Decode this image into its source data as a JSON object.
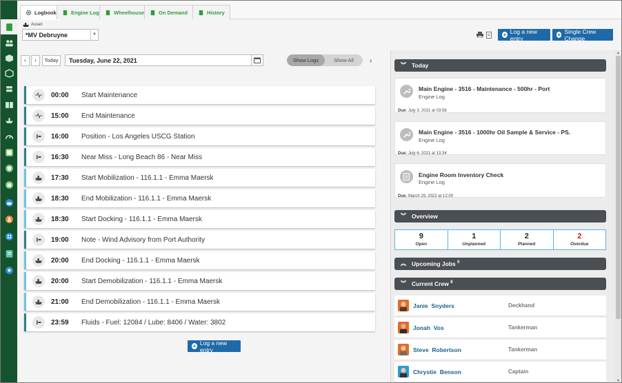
{
  "tabs": [
    {
      "label": "Logbook",
      "active": true
    },
    {
      "label": "Engine Log",
      "active": false
    },
    {
      "label": "Wheelhouse",
      "active": false
    },
    {
      "label": "On Demand",
      "active": false
    },
    {
      "label": "History",
      "active": false
    }
  ],
  "asset": {
    "label": "Asset",
    "value": "*MV Debruyne"
  },
  "toolbar": {
    "log_entry_label": "Log a new entry",
    "single_crew_label": "Single Crew Change",
    "today_label": "Today",
    "date": "Tuesday, June 22, 2021",
    "show_logs": "Show Logs",
    "show_all": "Show All"
  },
  "logs": [
    {
      "time": "00:00",
      "text": "Start Maintenance",
      "icon": "wave-icon"
    },
    {
      "time": "15:00",
      "text": "End Maintenance",
      "icon": "wave-icon"
    },
    {
      "time": "16:00",
      "text": "Position - Los Angeles USCG Station",
      "icon": "note-icon"
    },
    {
      "time": "16:30",
      "text": "Near Miss - Long Beach 86 - Near Miss",
      "icon": "note-icon"
    },
    {
      "time": "17:30",
      "text": "Start Mobilization - 116.1.1 - Emma Maersk",
      "icon": "ship-icon"
    },
    {
      "time": "18:30",
      "text": "End Mobilization - 116.1.1 - Emma Maersk",
      "icon": "ship-icon"
    },
    {
      "time": "18:30",
      "text": "Start Docking - 116.1.1 - Emma Maersk",
      "icon": "ship-icon"
    },
    {
      "time": "19:00",
      "text": "Note - Wind Advisory from Port Authority",
      "icon": "note-icon"
    },
    {
      "time": "20:00",
      "text": "End Docking - 116.1.1 - Emma Maersk",
      "icon": "ship-icon"
    },
    {
      "time": "20:00",
      "text": "Start Demobilization - 116.1.1 - Emma Maersk",
      "icon": "ship-icon"
    },
    {
      "time": "21:00",
      "text": "End Demobilization - 116.1.1 - Emma Maersk",
      "icon": "ship-icon"
    },
    {
      "time": "23:59",
      "text": "Fluids - Fuel: 12084 / Lube: 8406 / Water: 3802",
      "icon": "note-icon"
    }
  ],
  "bottom_button": "Log a new entry",
  "today": {
    "title": "Today",
    "jobs": [
      {
        "title": "Main Engine - 3516 - Maintenance - 500hr - Port",
        "sub": "Engine Log",
        "due_label": "Due:",
        "due": "July 3, 2021 at 03:58",
        "icon": "wrench-icon"
      },
      {
        "title": "Main Engine - 3516 - 1000hr Oil Sample & Service - PS.",
        "sub": "Engine Log",
        "due_label": "Due:",
        "due": "July 6, 2021 at 13:34",
        "icon": "wrench-icon"
      },
      {
        "title": "Engine Room Inventory Check",
        "sub": "Engine Log",
        "due_label": "Due:",
        "due": "March 29, 2022 at 12:00",
        "icon": "clipboard-icon"
      }
    ]
  },
  "overview": {
    "title": "Overview",
    "stats": [
      {
        "value": "9",
        "label": "Open"
      },
      {
        "value": "1",
        "label": "Unplanned"
      },
      {
        "value": "2",
        "label": "Planned"
      },
      {
        "value": "2",
        "label": "Overdue"
      }
    ]
  },
  "upcoming": {
    "title": "Upcoming Jobs",
    "count": "0"
  },
  "crew": {
    "title": "Current Crew",
    "count": "8",
    "members": [
      {
        "name": "Janie  Snyders",
        "role": "Deckhand"
      },
      {
        "name": "Jonah  Vos",
        "role": "Tankerman"
      },
      {
        "name": "Steve  Robertson",
        "role": "Tankerman"
      },
      {
        "name": "Chrystie  Benson",
        "role": "Captain"
      }
    ]
  },
  "colors": {
    "nav": "#14532d",
    "accent": "#1e6aa8",
    "tab_text": "#2e9c3a",
    "overdue": "#dd1111",
    "header_bar": "#4a4f54"
  }
}
